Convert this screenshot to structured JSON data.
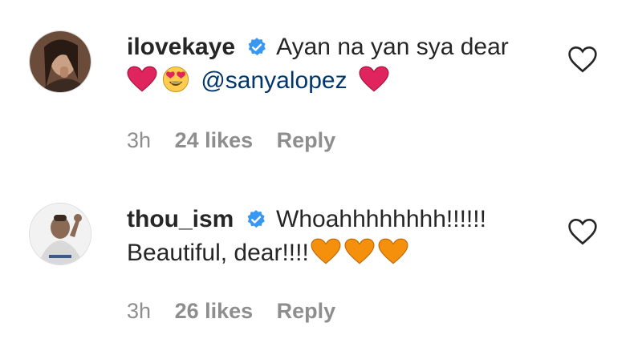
{
  "comments": [
    {
      "username": "ilovekaye",
      "text_line1": "Ayan na yan sya dear",
      "emojis_before_mention": [
        "red-heart",
        "heart-eyes"
      ],
      "mention": "@sanyalopez",
      "emojis_after_mention": [
        "red-heart"
      ],
      "time": "3h",
      "likes": "24 likes",
      "reply": "Reply",
      "verified": true
    },
    {
      "username": "thou_ism",
      "text_line1": "Whoahhhhhhhh!!!!!!",
      "text_line2": "Beautiful, dear!!!!",
      "emojis_after_text": [
        "orange-heart",
        "orange-heart",
        "orange-heart"
      ],
      "time": "3h",
      "likes": "26 likes",
      "reply": "Reply",
      "verified": true
    }
  ],
  "colors": {
    "verified_blue": "#3897f0",
    "red_heart": "#e0245e",
    "orange_heart": "#f4900c",
    "mention": "#00376b",
    "meta_gray": "#8e8e8e"
  }
}
